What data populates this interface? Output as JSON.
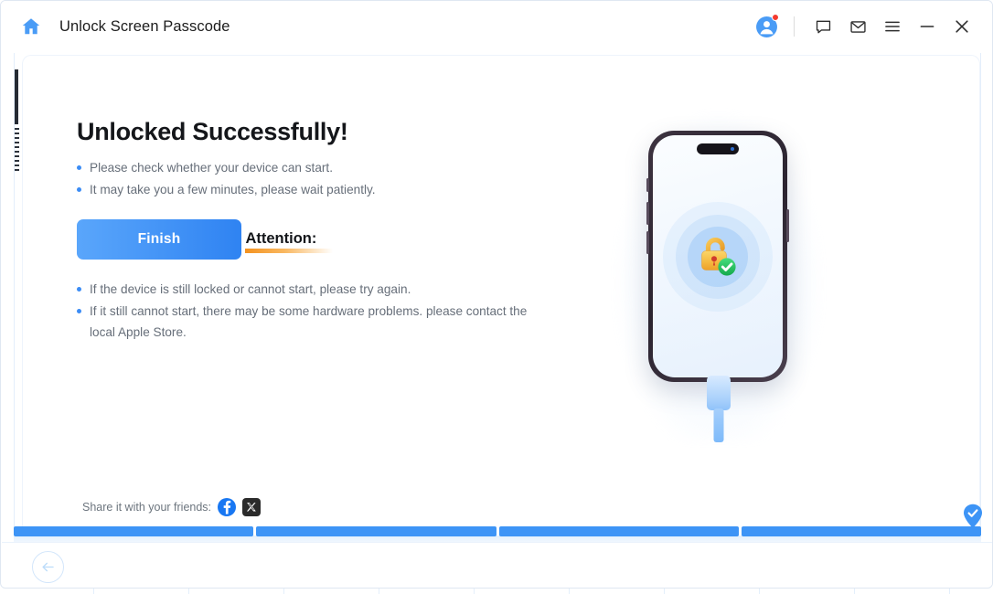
{
  "window": {
    "title": "Unlock Screen Passcode",
    "home_icon": "home-icon",
    "titlebar_icons": [
      {
        "name": "user-avatar-icon",
        "label": "Account"
      },
      {
        "name": "feedback-icon",
        "label": "Feedback"
      },
      {
        "name": "mail-icon",
        "label": "Mail"
      },
      {
        "name": "menu-icon",
        "label": "Menu"
      },
      {
        "name": "minimize-icon",
        "label": "Minimize"
      },
      {
        "name": "close-icon",
        "label": "Close"
      }
    ],
    "notification_dot_color": "#f43b2f"
  },
  "main": {
    "headline": "Unlocked Successfully!",
    "bullets": [
      "Please check whether your device can start.",
      "It may take you a few minutes, please wait patiently."
    ],
    "finish_label": "Finish",
    "attention_title": "Attention:",
    "attention_bullets": [
      "If the device is still locked or cannot start, please try again.",
      "If it still cannot start, there may be some hardware problems. please contact the local Apple Store."
    ]
  },
  "share": {
    "label": "Share it with your friends:",
    "networks": [
      {
        "name": "facebook-icon",
        "glyph": "f"
      },
      {
        "name": "x-twitter-icon",
        "glyph": "X"
      }
    ]
  },
  "illustration": {
    "device": "iphone-mockup",
    "screen_icon": "unlocked-padlock-with-check-icon",
    "accessory": "lightning-charging-cable",
    "lock_body_color": "#f5b73f",
    "lock_check_color": "#22c55e"
  },
  "progress": {
    "segments": [
      {
        "state": "done"
      },
      {
        "state": "done"
      },
      {
        "state": "done"
      },
      {
        "state": "done"
      }
    ],
    "badge_icon": "completed-check-pin-icon",
    "accent_color": "#3d94f6"
  },
  "footer": {
    "back_icon": "back-arrow-icon"
  },
  "colors": {
    "accent": "#3d94f6",
    "attention_underline": "#f4921f",
    "text_primary": "#14161a",
    "text_secondary": "#666e79"
  }
}
